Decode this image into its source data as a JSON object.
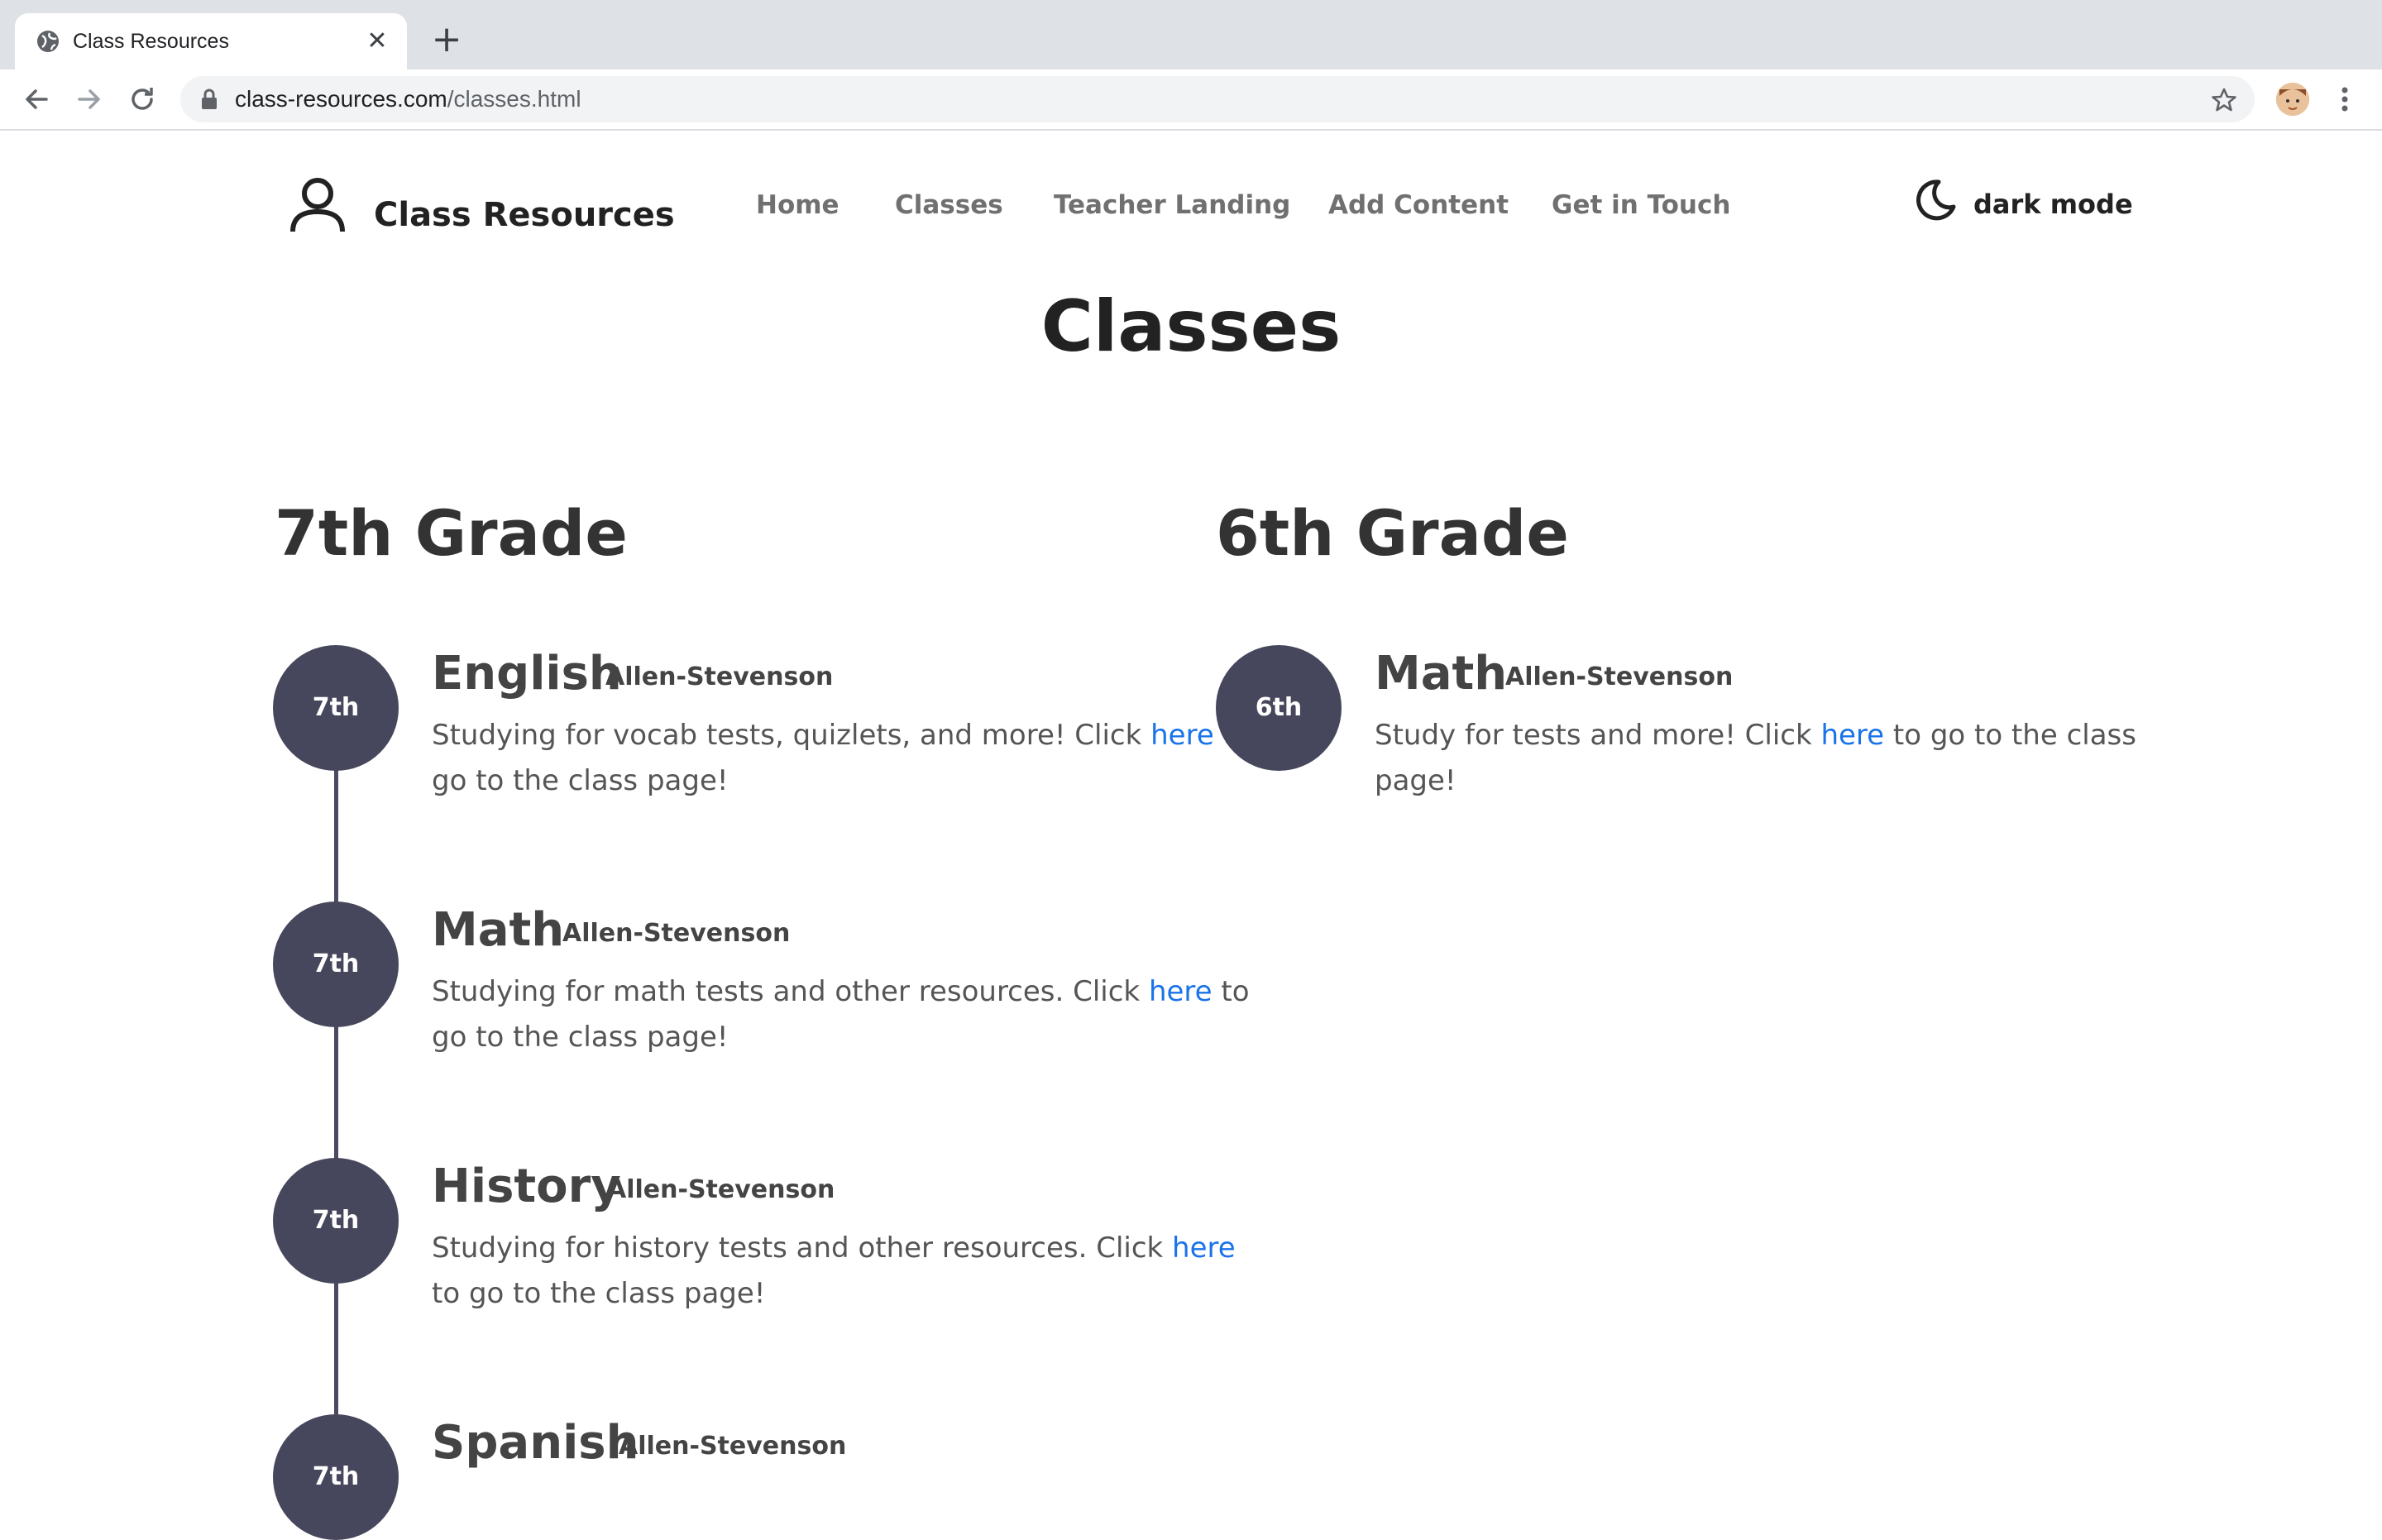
{
  "browser": {
    "tab_title": "Class Resources",
    "tab_close": "✕",
    "new_tab": "+",
    "url_domain": "class-resources.com",
    "url_path": "/classes.html"
  },
  "header": {
    "site_name": "Class Resources",
    "nav": [
      "Home",
      "Classes",
      "Teacher Landing",
      "Add Content",
      "Get in Touch"
    ],
    "dark_mode_label": "dark mode"
  },
  "page_title": "Classes",
  "grades": [
    {
      "heading": "7th Grade",
      "courses": [
        {
          "badge": "7th",
          "name": "English",
          "teacher": "Allen-Stevenson",
          "desc_before": "Studying for vocab tests, quizlets, and more! Click ",
          "link": "here",
          "desc_after": " to go to the class page!"
        },
        {
          "badge": "7th",
          "name": "Math",
          "teacher": "Allen-Stevenson",
          "desc_before": "Studying for math tests and other resources. Click ",
          "link": "here",
          "desc_after": " to go to the class page!"
        },
        {
          "badge": "7th",
          "name": "History",
          "teacher": "Allen-Stevenson",
          "desc_before": "Studying for history tests and other resources. Click ",
          "link": "here",
          "desc_after": " to go to the class page!"
        },
        {
          "badge": "7th",
          "name": "Spanish",
          "teacher": "Allen-Stevenson"
        }
      ]
    },
    {
      "heading": "6th Grade",
      "courses": [
        {
          "badge": "6th",
          "name": "Math",
          "teacher": "Allen-Stevenson",
          "desc_before": "Study for tests and more! Click ",
          "link": "here",
          "desc_after": " to go to the class page!"
        }
      ]
    }
  ],
  "colors": {
    "badge_bg": "#46465c",
    "link": "#1a73e8",
    "nav_text": "#707070"
  }
}
